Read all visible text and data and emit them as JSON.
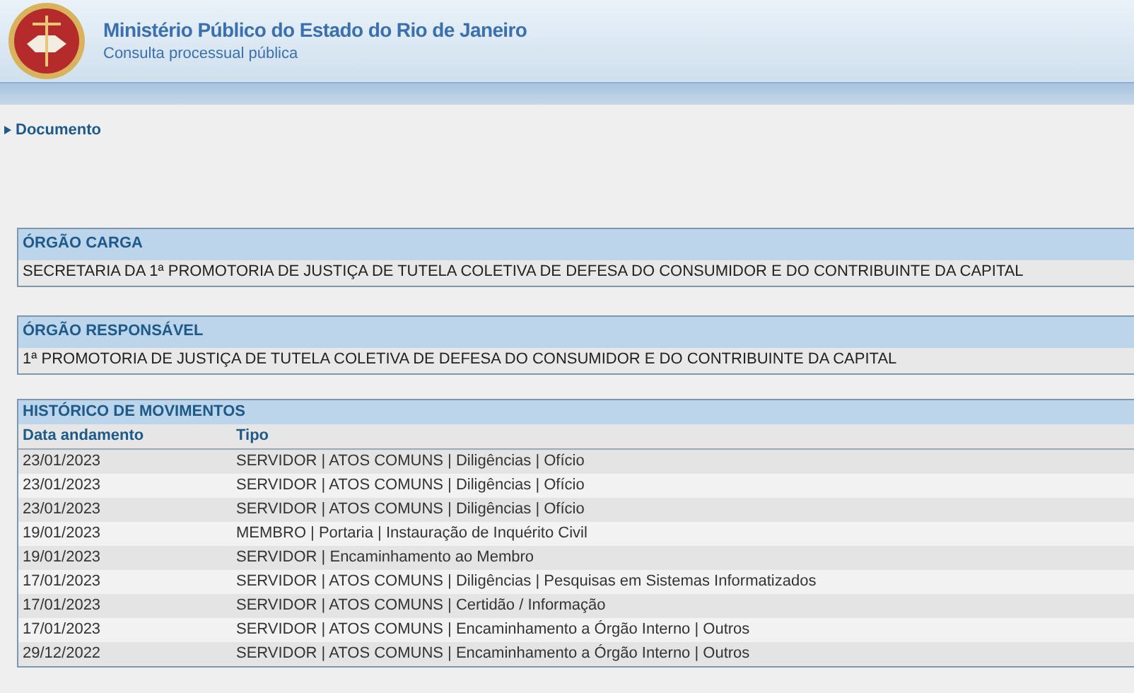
{
  "header": {
    "title": "Ministério Público do Estado do Rio de Janeiro",
    "subtitle": "Consulta processual pública"
  },
  "nav": {
    "link": "Documento",
    "expanded": false
  },
  "panels": [
    {
      "heading": "ÓRGÃO CARGA",
      "value": "SECRETARIA DA 1ª PROMOTORIA DE JUSTIÇA DE TUTELA COLETIVA DE DEFESA DO CONSUMIDOR E DO CONTRIBUINTE DA CAPITAL"
    },
    {
      "heading": "ÓRGÃO RESPONSÁVEL",
      "value": "1ª PROMOTORIA DE JUSTIÇA DE TUTELA COLETIVA DE DEFESA DO CONSUMIDOR E DO CONTRIBUINTE DA CAPITAL"
    }
  ],
  "history": {
    "heading": "HISTÓRICO DE MOVIMENTOS",
    "columns": [
      "Data andamento",
      "Tipo"
    ],
    "rows": [
      [
        "23/01/2023",
        "SERVIDOR | ATOS COMUNS | Diligências | Ofício"
      ],
      [
        "23/01/2023",
        "SERVIDOR | ATOS COMUNS | Diligências | Ofício"
      ],
      [
        "23/01/2023",
        "SERVIDOR | ATOS COMUNS | Diligências | Ofício"
      ],
      [
        "19/01/2023",
        "MEMBRO | Portaria | Instauração de Inquérito Civil"
      ],
      [
        "19/01/2023",
        "SERVIDOR | Encaminhamento ao Membro"
      ],
      [
        "17/01/2023",
        "SERVIDOR | ATOS COMUNS | Diligências | Pesquisas em Sistemas Informatizados"
      ],
      [
        "17/01/2023",
        "SERVIDOR | ATOS COMUNS | Certidão / Informação"
      ],
      [
        "17/01/2023",
        "SERVIDOR | ATOS COMUNS | Encaminhamento a Órgão Interno | Outros"
      ],
      [
        "29/12/2022",
        "SERVIDOR | ATOS COMUNS | Encaminhamento a Órgão Interno | Outros"
      ]
    ]
  }
}
